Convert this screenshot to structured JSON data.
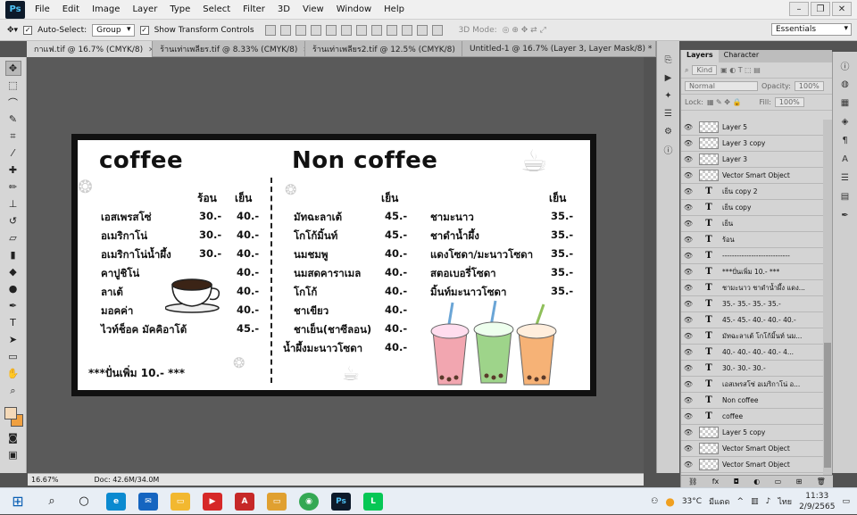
{
  "app": {
    "logo": "Ps"
  },
  "menu": [
    "File",
    "Edit",
    "Image",
    "Layer",
    "Type",
    "Select",
    "Filter",
    "3D",
    "View",
    "Window",
    "Help"
  ],
  "options": {
    "auto_select_label": "Auto-Select:",
    "auto_select_value": "Group",
    "transform_label": "Show Transform Controls",
    "mode3d_label": "3D Mode:",
    "workspace": "Essentials"
  },
  "tabs": [
    {
      "label": "กาแฟ.tif @ 16.7% (CMYK/8)"
    },
    {
      "label": "ร้านเท่าเพลียร.tif @ 8.33% (CMYK/8)"
    },
    {
      "label": "ร้านเท่าเพลียร2.tif @ 12.5% (CMYK/8)"
    },
    {
      "label": "Untitled-1 @ 16.7% (Layer 3, Layer Mask/8) *"
    }
  ],
  "status": {
    "zoom": "16.67%",
    "doc": "Doc: 42.6M/34.0M"
  },
  "menu_card": {
    "coffee_title": "coffee",
    "noncoffee_title": "Non  coffee",
    "hot_label": "ร้อน",
    "cold_label": "เย็น",
    "coffee_items": [
      {
        "name": "เอสเพรสโซ่",
        "hot": "30.-",
        "cold": "40.-"
      },
      {
        "name": "อเมริกาโน่",
        "hot": "30.-",
        "cold": "40.-"
      },
      {
        "name": "อเมริกาโน่น้ำผึ้ง",
        "hot": "30.-",
        "cold": "40.-"
      },
      {
        "name": "คาปูชิโน่",
        "hot": "",
        "cold": "40.-"
      },
      {
        "name": "ลาเต้",
        "hot": "",
        "cold": "40.-"
      },
      {
        "name": "มอคค่า",
        "hot": "",
        "cold": "40.-"
      },
      {
        "name": "ไวท์ช็อค มัคคิอาโต้",
        "hot": "",
        "cold": "45.-"
      }
    ],
    "noncoffee_col1": [
      {
        "name": "มัทฉะลาเต้",
        "price": "45.-"
      },
      {
        "name": "โกโก้มิ้นท์",
        "price": "45.-"
      },
      {
        "name": "นมชมพู",
        "price": "40.-"
      },
      {
        "name": "นมสดคาราเมล",
        "price": "40.-"
      },
      {
        "name": "โกโก้",
        "price": "40.-"
      },
      {
        "name": "ชาเขียว",
        "price": "40.-"
      },
      {
        "name": "ชาเย็น(ชาซีลอน)",
        "price": "40.-"
      },
      {
        "name": "น้ำผึ้งมะนาวโซดา",
        "price": "40.-"
      }
    ],
    "noncoffee_col2": [
      {
        "name": "ชามะนาว",
        "price": "35.-"
      },
      {
        "name": "ชาดำน้ำผึ้ง",
        "price": "35.-"
      },
      {
        "name": "แดงโซดา/มะนาวโซดา",
        "price": "35.-"
      },
      {
        "name": "สตอเบอรี่โซดา",
        "price": "35.-"
      },
      {
        "name": "มิ้นท์มะนาวโซดา",
        "price": "35.-"
      }
    ],
    "extra_shot": "***ปั่นเพิ่ม 10.- ***"
  },
  "layers_panel": {
    "tab_layers": "Layers",
    "tab_character": "Character",
    "filter_kind": "Kind",
    "blend_mode": "Normal",
    "opacity_label": "Opacity:",
    "opacity_value": "100%",
    "lock_label": "Lock:",
    "fill_label": "Fill:",
    "fill_value": "100%",
    "layers": [
      {
        "name": "Layer 5",
        "type": "pixel"
      },
      {
        "name": "Layer 3 copy",
        "type": "pixel"
      },
      {
        "name": "Layer 3",
        "type": "pixel"
      },
      {
        "name": "Vector Smart Object",
        "type": "smart"
      },
      {
        "name": "เย็น copy 2",
        "type": "text"
      },
      {
        "name": "เย็น copy",
        "type": "text"
      },
      {
        "name": "เย็น",
        "type": "text"
      },
      {
        "name": "ร้อน",
        "type": "text"
      },
      {
        "name": "----------------------------",
        "type": "text"
      },
      {
        "name": "***ปั่นเพิ่ม 10.- ***",
        "type": "text"
      },
      {
        "name": "ชามะนาว ชาดำน้ำผึ้ง แดง...",
        "type": "text"
      },
      {
        "name": "35.- 35.- 35.- 35.-",
        "type": "text"
      },
      {
        "name": "45.- 45.- 40.- 40.- 40.-",
        "type": "text"
      },
      {
        "name": "มัทฉะลาเต้ โกโก้มิ้นท์ นม...",
        "type": "text"
      },
      {
        "name": "40.- 40.- 40.- 40.- 4...",
        "type": "text"
      },
      {
        "name": "30.- 30.- 30.-",
        "type": "text"
      },
      {
        "name": "เอสเพรสโซ่ อเมริกาโน่ อ...",
        "type": "text"
      },
      {
        "name": "Non coffee",
        "type": "text"
      },
      {
        "name": "coffee",
        "type": "text"
      },
      {
        "name": "Layer 5 copy",
        "type": "pixel"
      },
      {
        "name": "Vector Smart Object",
        "type": "smart"
      },
      {
        "name": "Vector Smart Object",
        "type": "smart"
      }
    ]
  },
  "taskbar": {
    "temp": "33°C",
    "weather": "มีแดด",
    "lang": "ไทย",
    "time": "11:33",
    "date": "2/9/2565"
  },
  "colors": {
    "foreground": "#f4d9b8",
    "background": "#f0a040"
  }
}
